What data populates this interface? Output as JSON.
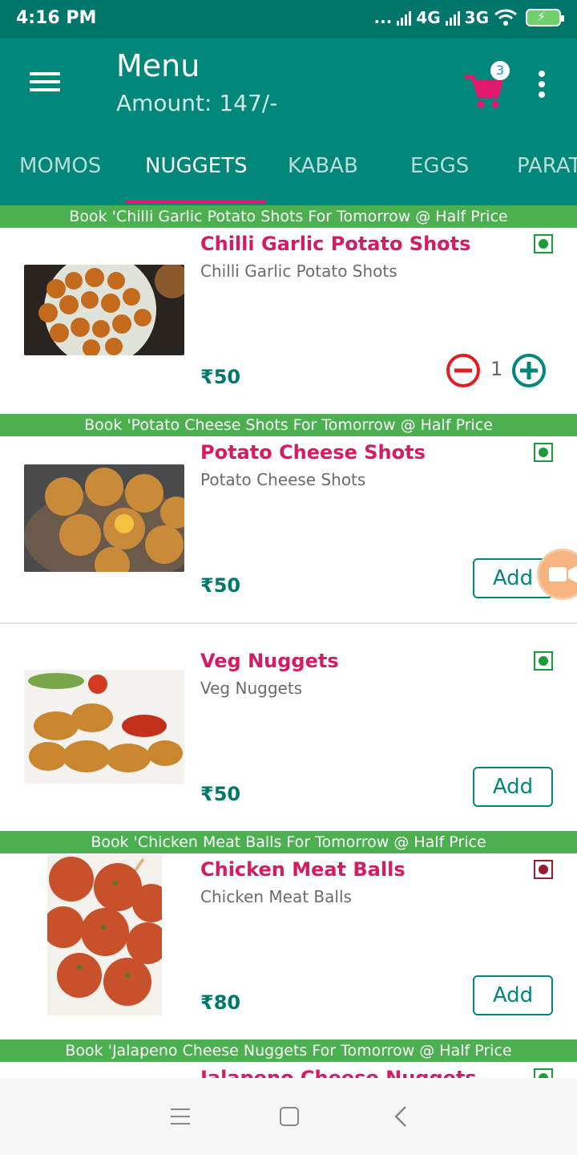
{
  "status_bar": {
    "time": "4:16 PM",
    "dots": "...",
    "net1": "4G",
    "net2": "3G"
  },
  "app_bar": {
    "title": "Menu",
    "amount": "Amount: 147/-",
    "cart_count": "3",
    "icons": [
      "hamburger-menu-icon",
      "shopping-cart-icon",
      "overflow-menu-icon"
    ]
  },
  "tabs": [
    {
      "label": "MOMOS",
      "active": false
    },
    {
      "label": "NUGGETS",
      "active": true
    },
    {
      "label": "KABAB",
      "active": false
    },
    {
      "label": "EGGS",
      "active": false
    },
    {
      "label": "PARAT",
      "active": false
    }
  ],
  "items": [
    {
      "banner": "Book 'Chilli Garlic Potato Shots For Tomorrow @ Half Price",
      "name": "Chilli Garlic Potato Shots",
      "desc": "Chilli Garlic Potato Shots",
      "price": "₹50",
      "type": "veg",
      "quantity": "1"
    },
    {
      "banner": "Book 'Potato Cheese Shots For Tomorrow @ Half Price",
      "name": "Potato Cheese Shots",
      "desc": "Potato Cheese Shots",
      "price": "₹50",
      "type": "veg",
      "button": "Add"
    },
    {
      "name": "Veg Nuggets",
      "desc": "Veg Nuggets",
      "price": "₹50",
      "type": "veg",
      "button": "Add"
    },
    {
      "banner": "Book 'Chicken Meat Balls For Tomorrow @ Half Price",
      "name": "Chicken Meat Balls",
      "desc": "Chicken Meat Balls",
      "price": "₹80",
      "type": "non-veg",
      "button": "Add"
    },
    {
      "banner": "Book 'Jalapeno Cheese Nuggets For Tomorrow @ Half Price",
      "name": "Jalapeno Cheese Nuggets",
      "type": "veg"
    }
  ],
  "colors": {
    "status_bar": "#00766a",
    "app_bar": "#00877a",
    "accent_pink": "#e0186c",
    "banner_green": "#4caf50",
    "price_teal": "#00796b",
    "veg_green": "#1a9c3a",
    "nonveg_red": "#9b1b30",
    "qty_minus": "#e51c23"
  }
}
